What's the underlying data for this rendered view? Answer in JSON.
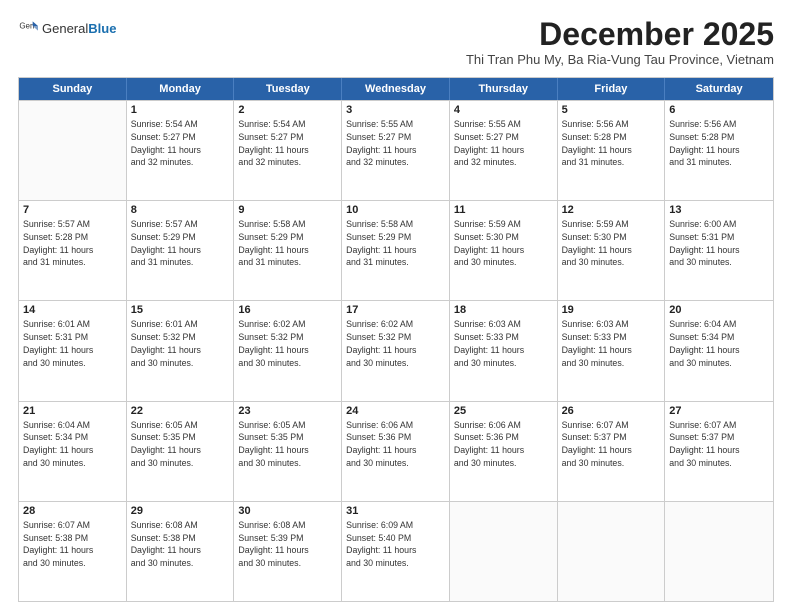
{
  "logo": {
    "general": "General",
    "blue": "Blue"
  },
  "title": "December 2025",
  "subtitle": "Thi Tran Phu My, Ba Ria-Vung Tau Province, Vietnam",
  "header_days": [
    "Sunday",
    "Monday",
    "Tuesday",
    "Wednesday",
    "Thursday",
    "Friday",
    "Saturday"
  ],
  "weeks": [
    [
      {
        "day": "",
        "info": ""
      },
      {
        "day": "1",
        "info": "Sunrise: 5:54 AM\nSunset: 5:27 PM\nDaylight: 11 hours\nand 32 minutes."
      },
      {
        "day": "2",
        "info": "Sunrise: 5:54 AM\nSunset: 5:27 PM\nDaylight: 11 hours\nand 32 minutes."
      },
      {
        "day": "3",
        "info": "Sunrise: 5:55 AM\nSunset: 5:27 PM\nDaylight: 11 hours\nand 32 minutes."
      },
      {
        "day": "4",
        "info": "Sunrise: 5:55 AM\nSunset: 5:27 PM\nDaylight: 11 hours\nand 32 minutes."
      },
      {
        "day": "5",
        "info": "Sunrise: 5:56 AM\nSunset: 5:28 PM\nDaylight: 11 hours\nand 31 minutes."
      },
      {
        "day": "6",
        "info": "Sunrise: 5:56 AM\nSunset: 5:28 PM\nDaylight: 11 hours\nand 31 minutes."
      }
    ],
    [
      {
        "day": "7",
        "info": "Sunrise: 5:57 AM\nSunset: 5:28 PM\nDaylight: 11 hours\nand 31 minutes."
      },
      {
        "day": "8",
        "info": "Sunrise: 5:57 AM\nSunset: 5:29 PM\nDaylight: 11 hours\nand 31 minutes."
      },
      {
        "day": "9",
        "info": "Sunrise: 5:58 AM\nSunset: 5:29 PM\nDaylight: 11 hours\nand 31 minutes."
      },
      {
        "day": "10",
        "info": "Sunrise: 5:58 AM\nSunset: 5:29 PM\nDaylight: 11 hours\nand 31 minutes."
      },
      {
        "day": "11",
        "info": "Sunrise: 5:59 AM\nSunset: 5:30 PM\nDaylight: 11 hours\nand 30 minutes."
      },
      {
        "day": "12",
        "info": "Sunrise: 5:59 AM\nSunset: 5:30 PM\nDaylight: 11 hours\nand 30 minutes."
      },
      {
        "day": "13",
        "info": "Sunrise: 6:00 AM\nSunset: 5:31 PM\nDaylight: 11 hours\nand 30 minutes."
      }
    ],
    [
      {
        "day": "14",
        "info": "Sunrise: 6:01 AM\nSunset: 5:31 PM\nDaylight: 11 hours\nand 30 minutes."
      },
      {
        "day": "15",
        "info": "Sunrise: 6:01 AM\nSunset: 5:32 PM\nDaylight: 11 hours\nand 30 minutes."
      },
      {
        "day": "16",
        "info": "Sunrise: 6:02 AM\nSunset: 5:32 PM\nDaylight: 11 hours\nand 30 minutes."
      },
      {
        "day": "17",
        "info": "Sunrise: 6:02 AM\nSunset: 5:32 PM\nDaylight: 11 hours\nand 30 minutes."
      },
      {
        "day": "18",
        "info": "Sunrise: 6:03 AM\nSunset: 5:33 PM\nDaylight: 11 hours\nand 30 minutes."
      },
      {
        "day": "19",
        "info": "Sunrise: 6:03 AM\nSunset: 5:33 PM\nDaylight: 11 hours\nand 30 minutes."
      },
      {
        "day": "20",
        "info": "Sunrise: 6:04 AM\nSunset: 5:34 PM\nDaylight: 11 hours\nand 30 minutes."
      }
    ],
    [
      {
        "day": "21",
        "info": "Sunrise: 6:04 AM\nSunset: 5:34 PM\nDaylight: 11 hours\nand 30 minutes."
      },
      {
        "day": "22",
        "info": "Sunrise: 6:05 AM\nSunset: 5:35 PM\nDaylight: 11 hours\nand 30 minutes."
      },
      {
        "day": "23",
        "info": "Sunrise: 6:05 AM\nSunset: 5:35 PM\nDaylight: 11 hours\nand 30 minutes."
      },
      {
        "day": "24",
        "info": "Sunrise: 6:06 AM\nSunset: 5:36 PM\nDaylight: 11 hours\nand 30 minutes."
      },
      {
        "day": "25",
        "info": "Sunrise: 6:06 AM\nSunset: 5:36 PM\nDaylight: 11 hours\nand 30 minutes."
      },
      {
        "day": "26",
        "info": "Sunrise: 6:07 AM\nSunset: 5:37 PM\nDaylight: 11 hours\nand 30 minutes."
      },
      {
        "day": "27",
        "info": "Sunrise: 6:07 AM\nSunset: 5:37 PM\nDaylight: 11 hours\nand 30 minutes."
      }
    ],
    [
      {
        "day": "28",
        "info": "Sunrise: 6:07 AM\nSunset: 5:38 PM\nDaylight: 11 hours\nand 30 minutes."
      },
      {
        "day": "29",
        "info": "Sunrise: 6:08 AM\nSunset: 5:38 PM\nDaylight: 11 hours\nand 30 minutes."
      },
      {
        "day": "30",
        "info": "Sunrise: 6:08 AM\nSunset: 5:39 PM\nDaylight: 11 hours\nand 30 minutes."
      },
      {
        "day": "31",
        "info": "Sunrise: 6:09 AM\nSunset: 5:40 PM\nDaylight: 11 hours\nand 30 minutes."
      },
      {
        "day": "",
        "info": ""
      },
      {
        "day": "",
        "info": ""
      },
      {
        "day": "",
        "info": ""
      }
    ]
  ]
}
